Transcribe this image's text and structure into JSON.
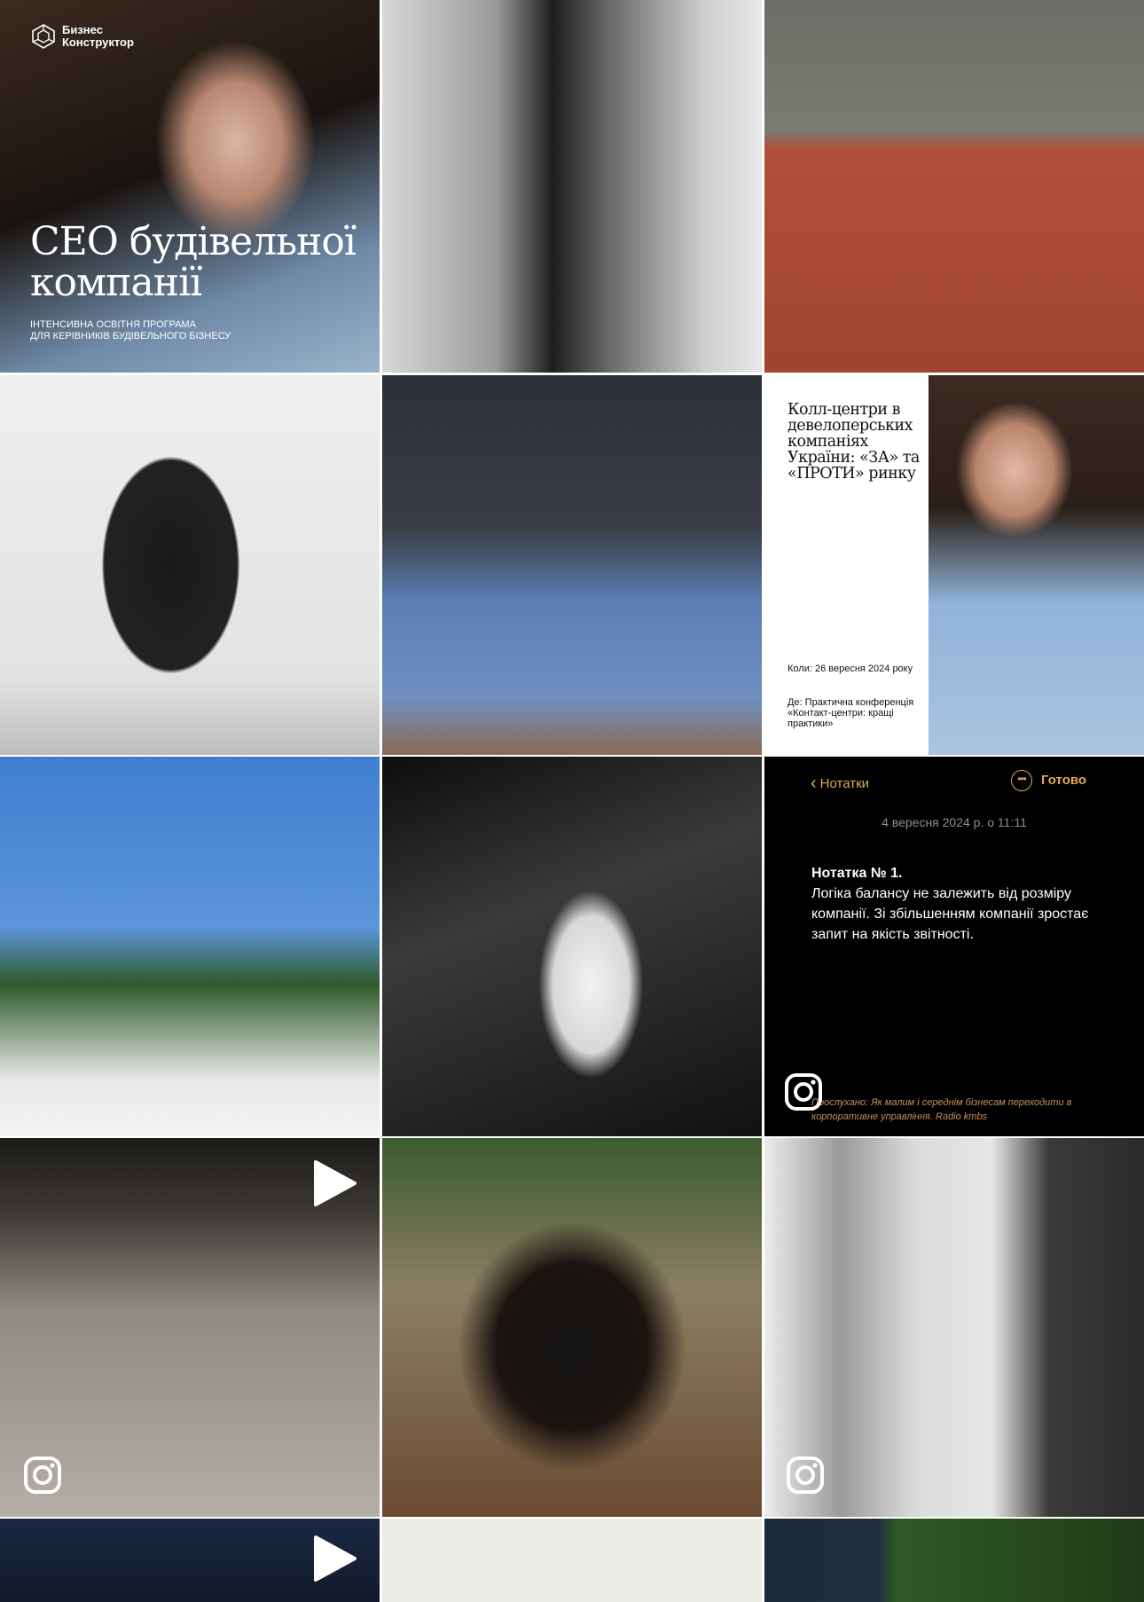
{
  "tiles": {
    "ceo": {
      "logo_line1": "Бизнес",
      "logo_line2": "Конструктор",
      "title_line1": "CEO будівельної",
      "title_line2": "компанії",
      "subtitle_line1": "Інтенсивна освітня програма",
      "subtitle_line2": "для керівників будівельного бізнесу"
    },
    "call_centers": {
      "title": "Колл-центри в девелоперських компаніях України: «ЗА» та «ПРОТИ» ринку",
      "when": "Коли: 26 вересня 2024 року",
      "where": "Де: Практична конференція «Контакт-центри: кращі практики»"
    },
    "note": {
      "back_label": "Нотатки",
      "done_label": "Готово",
      "date": "4 вересня 2024 р. о 11:11",
      "heading": "Нотатка № 1.",
      "text": "Логіка балансу не залежить від розміру компанії. Зі збільшенням компанії зростає запит на якість звітності.",
      "footer": "Прослухано: Як малим і середнім бізнесам переходити в корпоративне управління. Radio kmbs"
    }
  },
  "icons": {
    "instagram": "instagram-icon",
    "play": "play-icon",
    "logo": "logo-mark-icon",
    "more": "more-icon",
    "back": "chevron-left-icon"
  },
  "colors": {
    "note_accent": "#e0a85a",
    "note_background": "#000000"
  }
}
